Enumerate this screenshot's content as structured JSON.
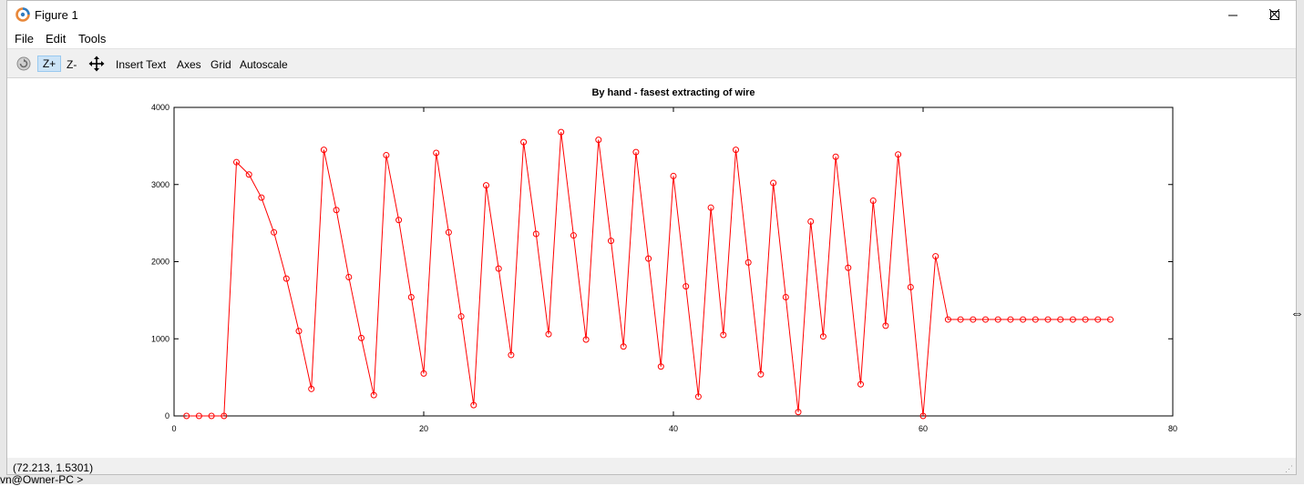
{
  "backdrop": {
    "terminal_fragment": "vn@Owner-PC >"
  },
  "window": {
    "title": "Figure 1",
    "icon": "octave-logo-icon",
    "controls": [
      "minimize-icon",
      "maximize-icon",
      "close-icon"
    ]
  },
  "menubar": {
    "file": "File",
    "edit": "Edit",
    "tools": "Tools"
  },
  "toolbar": {
    "rotate_icon": "rotate-icon",
    "zoom_in": "Z+",
    "zoom_out": "Z-",
    "pan_icon": "pan-icon",
    "insert_text": "Insert Text",
    "axes": "Axes",
    "grid": "Grid",
    "autoscale": "Autoscale"
  },
  "status": {
    "coords": "(72.213, 1.5301)"
  },
  "chart_data": {
    "type": "line",
    "title": "By hand -  fasest extracting of wire",
    "xlabel": "",
    "ylabel": "",
    "xlim": [
      0,
      80
    ],
    "ylim": [
      0,
      4000
    ],
    "xticks": [
      "0",
      "20",
      "40",
      "60",
      "80"
    ],
    "yticks": [
      "0",
      "1000",
      "2000",
      "3000",
      "4000"
    ],
    "grid": false,
    "series": [
      {
        "color": "#ff0000",
        "marker": "circle",
        "x": [
          1,
          2,
          3,
          4,
          5,
          6,
          7,
          8,
          9,
          10,
          11,
          12,
          13,
          14,
          15,
          16,
          17,
          18,
          19,
          20,
          21,
          22,
          23,
          24,
          25,
          26,
          27,
          28,
          29,
          30,
          31,
          32,
          33,
          34,
          35,
          36,
          37,
          38,
          39,
          40,
          41,
          42,
          43,
          44,
          45,
          46,
          47,
          48,
          49,
          50,
          51,
          52,
          53,
          54,
          55,
          56,
          57,
          58,
          59,
          60,
          61,
          62,
          63,
          64,
          65,
          66,
          67,
          68,
          69,
          70,
          71,
          72,
          73,
          74,
          75
        ],
        "y": [
          0,
          0,
          0,
          0,
          3290,
          3130,
          2830,
          2380,
          1780,
          1100,
          350,
          3450,
          2670,
          1800,
          1010,
          270,
          3380,
          2540,
          1540,
          550,
          3410,
          2380,
          1290,
          140,
          2990,
          1910,
          790,
          3550,
          2360,
          1060,
          3680,
          2340,
          990,
          3580,
          2270,
          900,
          3420,
          2040,
          640,
          3110,
          1680,
          250,
          2700,
          1050,
          3450,
          1990,
          540,
          3020,
          1540,
          50,
          2520,
          1030,
          3360,
          1920,
          410,
          2790,
          1170,
          3390,
          1670,
          0,
          2070,
          1250,
          1250,
          1250,
          1250,
          1250,
          1250,
          1250,
          1250,
          1250,
          1250,
          1250,
          1250,
          1250,
          1250
        ]
      }
    ]
  }
}
